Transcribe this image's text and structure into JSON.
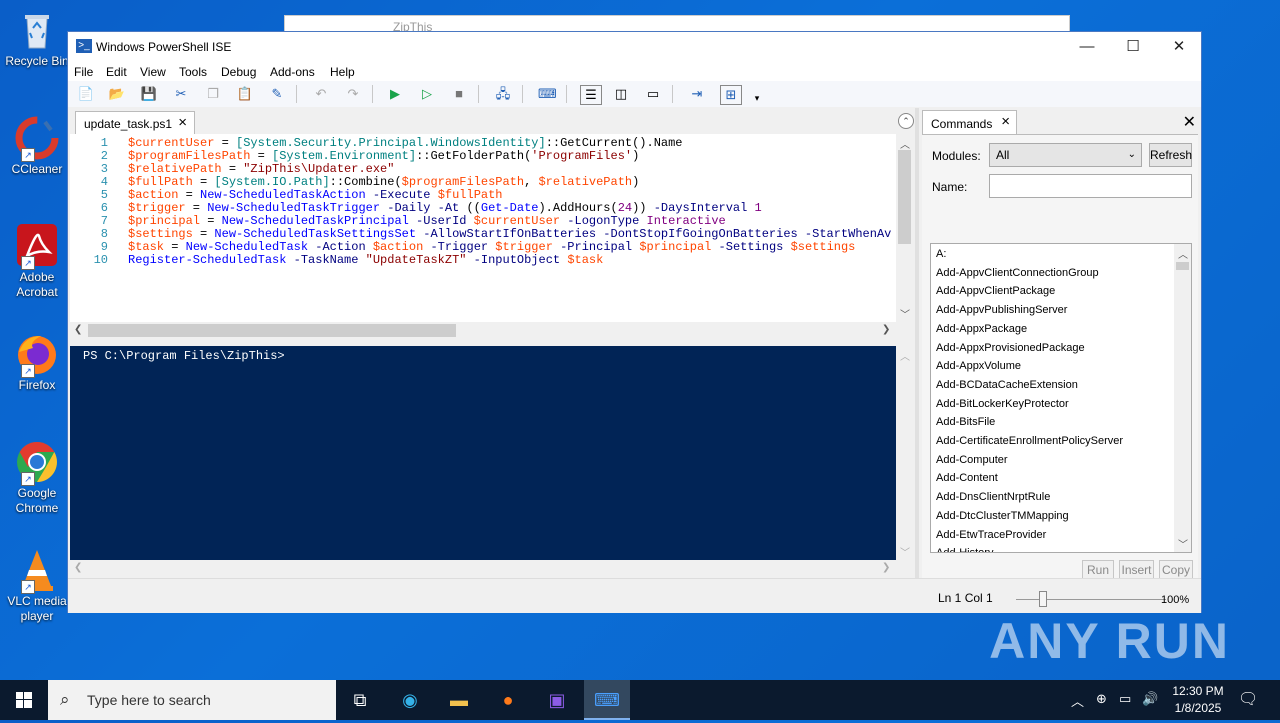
{
  "desktop": {
    "icons": [
      {
        "label": "Recycle Bin"
      },
      {
        "label": "CCleaner"
      },
      {
        "label": "Adobe Acrobat"
      },
      {
        "label": "Firefox"
      },
      {
        "label": "Google Chrome"
      },
      {
        "label": "VLC media player"
      }
    ],
    "watermark": "ANY RUN",
    "background_window_title": "ZipThis"
  },
  "window": {
    "title": "Windows PowerShell ISE",
    "menu": [
      "File",
      "Edit",
      "View",
      "Tools",
      "Debug",
      "Add-ons",
      "Help"
    ]
  },
  "editor": {
    "tab_label": "update_task.ps1",
    "lines": [
      {
        "num": "1",
        "tokens": [
          [
            "v",
            "$currentUser"
          ],
          [
            "m",
            " = "
          ],
          [
            "t",
            "[System.Security.Principal.WindowsIdentity]"
          ],
          [
            "m",
            "::GetCurrent().Name"
          ]
        ]
      },
      {
        "num": "2",
        "tokens": [
          [
            "v",
            "$programFilesPath"
          ],
          [
            "m",
            " = "
          ],
          [
            "t",
            "[System.Environment]"
          ],
          [
            "m",
            "::GetFolderPath("
          ],
          [
            "s",
            "'ProgramFiles'"
          ],
          [
            "m",
            ")"
          ]
        ]
      },
      {
        "num": "3",
        "tokens": [
          [
            "v",
            "$relativePath"
          ],
          [
            "m",
            " = "
          ],
          [
            "s",
            "\"ZipThis\\Updater.exe\""
          ]
        ]
      },
      {
        "num": "4",
        "tokens": [
          [
            "v",
            "$fullPath"
          ],
          [
            "m",
            " = "
          ],
          [
            "t",
            "[System.IO.Path]"
          ],
          [
            "m",
            "::Combine("
          ],
          [
            "v",
            "$programFilesPath"
          ],
          [
            "m",
            ", "
          ],
          [
            "v",
            "$relativePath"
          ],
          [
            "m",
            ")"
          ]
        ]
      },
      {
        "num": "5",
        "tokens": [
          [
            "v",
            "$action"
          ],
          [
            "m",
            " = "
          ],
          [
            "c",
            "New-ScheduledTaskAction"
          ],
          [
            "p",
            " -Execute "
          ],
          [
            "v",
            "$fullPath"
          ]
        ]
      },
      {
        "num": "6",
        "tokens": [
          [
            "v",
            "$trigger"
          ],
          [
            "m",
            " = "
          ],
          [
            "c",
            "New-ScheduledTaskTrigger"
          ],
          [
            "p",
            " -Daily -At "
          ],
          [
            "m",
            "(("
          ],
          [
            "c",
            "Get-Date"
          ],
          [
            "m",
            ").AddHours("
          ],
          [
            "n",
            "24"
          ],
          [
            "m",
            "))"
          ],
          [
            "p",
            " -DaysInterval "
          ],
          [
            "n",
            "1"
          ]
        ]
      },
      {
        "num": "7",
        "tokens": [
          [
            "v",
            "$principal"
          ],
          [
            "m",
            " = "
          ],
          [
            "c",
            "New-ScheduledTaskPrincipal"
          ],
          [
            "p",
            " -UserId "
          ],
          [
            "v",
            "$currentUser"
          ],
          [
            "p",
            " -LogonType "
          ],
          [
            "n",
            "Interactive"
          ]
        ]
      },
      {
        "num": "8",
        "tokens": [
          [
            "v",
            "$settings"
          ],
          [
            "m",
            " = "
          ],
          [
            "c",
            "New-ScheduledTaskSettingsSet"
          ],
          [
            "p",
            " -AllowStartIfOnBatteries -DontStopIfGoingOnBatteries -StartWhenAv"
          ]
        ]
      },
      {
        "num": "9",
        "tokens": [
          [
            "v",
            "$task"
          ],
          [
            "m",
            " = "
          ],
          [
            "c",
            "New-ScheduledTask"
          ],
          [
            "p",
            " -Action "
          ],
          [
            "v",
            "$action"
          ],
          [
            "p",
            " -Trigger "
          ],
          [
            "v",
            "$trigger"
          ],
          [
            "p",
            " -Principal "
          ],
          [
            "v",
            "$principal"
          ],
          [
            "p",
            " -Settings "
          ],
          [
            "v",
            "$settings"
          ]
        ]
      },
      {
        "num": "10",
        "tokens": [
          [
            "c",
            "Register-ScheduledTask"
          ],
          [
            "p",
            " -TaskName "
          ],
          [
            "s",
            "\"UpdateTaskZT\""
          ],
          [
            "p",
            " -InputObject "
          ],
          [
            "v",
            "$task"
          ]
        ]
      }
    ]
  },
  "console": {
    "prompt": "PS C:\\Program Files\\ZipThis>"
  },
  "commands": {
    "tab_label": "Commands",
    "modules_label": "Modules:",
    "modules_value": "All",
    "refresh_label": "Refresh",
    "name_label": "Name:",
    "name_value": "",
    "items": [
      "A:",
      "Add-AppvClientConnectionGroup",
      "Add-AppvClientPackage",
      "Add-AppvPublishingServer",
      "Add-AppxPackage",
      "Add-AppxProvisionedPackage",
      "Add-AppxVolume",
      "Add-BCDataCacheExtension",
      "Add-BitLockerKeyProtector",
      "Add-BitsFile",
      "Add-CertificateEnrollmentPolicyServer",
      "Add-Computer",
      "Add-Content",
      "Add-DnsClientNrptRule",
      "Add-DtcClusterTMMapping",
      "Add-EtwTraceProvider",
      "Add-History"
    ],
    "run_label": "Run",
    "insert_label": "Insert",
    "copy_label": "Copy"
  },
  "status": {
    "position": "Ln 1  Col 1",
    "zoom": "100%",
    "zoom_level": 1.0
  },
  "taskbar": {
    "search_placeholder": "Type here to search",
    "time": "12:30 PM",
    "date": "1/8/2025"
  },
  "colors": {
    "console_bg": "#012456",
    "accent": "#0078d7",
    "variable": "#ff4500",
    "command": "#0000ff"
  }
}
